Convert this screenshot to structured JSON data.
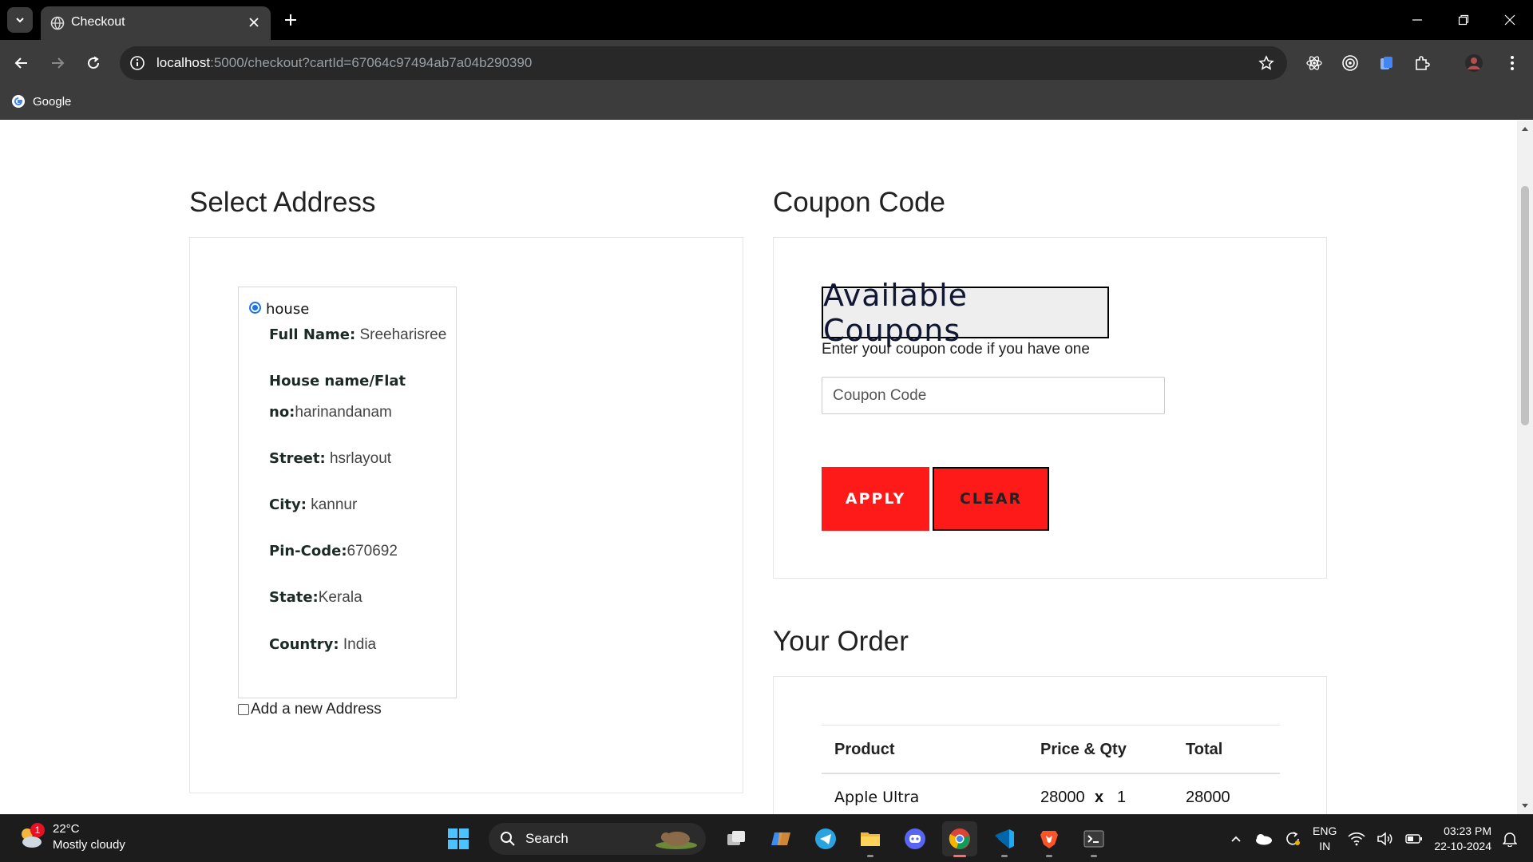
{
  "browser": {
    "tab_title": "Checkout",
    "url_host": "localhost",
    "url_rest": ":5000/checkout?cartId=67064c97494ab7a04b290390",
    "bookmark": "Google"
  },
  "address_section": {
    "title": "Select Address",
    "address": {
      "type": "house",
      "full_name_label": "Full Name:",
      "full_name": "Sreeharisree",
      "house_label": "House name/Flat no:",
      "house": "harinandanam",
      "street_label": "Street:",
      "street": "hsrlayout",
      "city_label": "City:",
      "city": "kannur",
      "pin_label": "Pin-Code:",
      "pin": "670692",
      "state_label": "State:",
      "state": "Kerala",
      "country_label": "Country:",
      "country": "India"
    },
    "new_address_label": "Add a new Address"
  },
  "coupon_section": {
    "title": "Coupon Code",
    "heading": "Available Coupons",
    "hint": "Enter your coupon code if you have one",
    "input_placeholder": "Coupon Code",
    "apply_label": "APPLY",
    "clear_label": "CLEAR"
  },
  "order_section": {
    "title": "Your Order",
    "headers": [
      "Product",
      "Price & Qty",
      "Total"
    ],
    "rows": [
      {
        "product": "Apple Ultra",
        "price": "28000",
        "times": "x",
        "qty": "1",
        "total": "28000"
      }
    ]
  },
  "taskbar": {
    "weather_temp": "22°C",
    "weather_desc": "Mostly cloudy",
    "weather_badge": "1",
    "search_label": "Search",
    "lang_line1": "ENG",
    "lang_line2": "IN",
    "time": "03:23 PM",
    "date": "22-10-2024"
  },
  "colors": {
    "accent_red": "#ff1a1a",
    "radio_blue": "#1a73e8",
    "chrome_dark": "#3c3c3c"
  }
}
